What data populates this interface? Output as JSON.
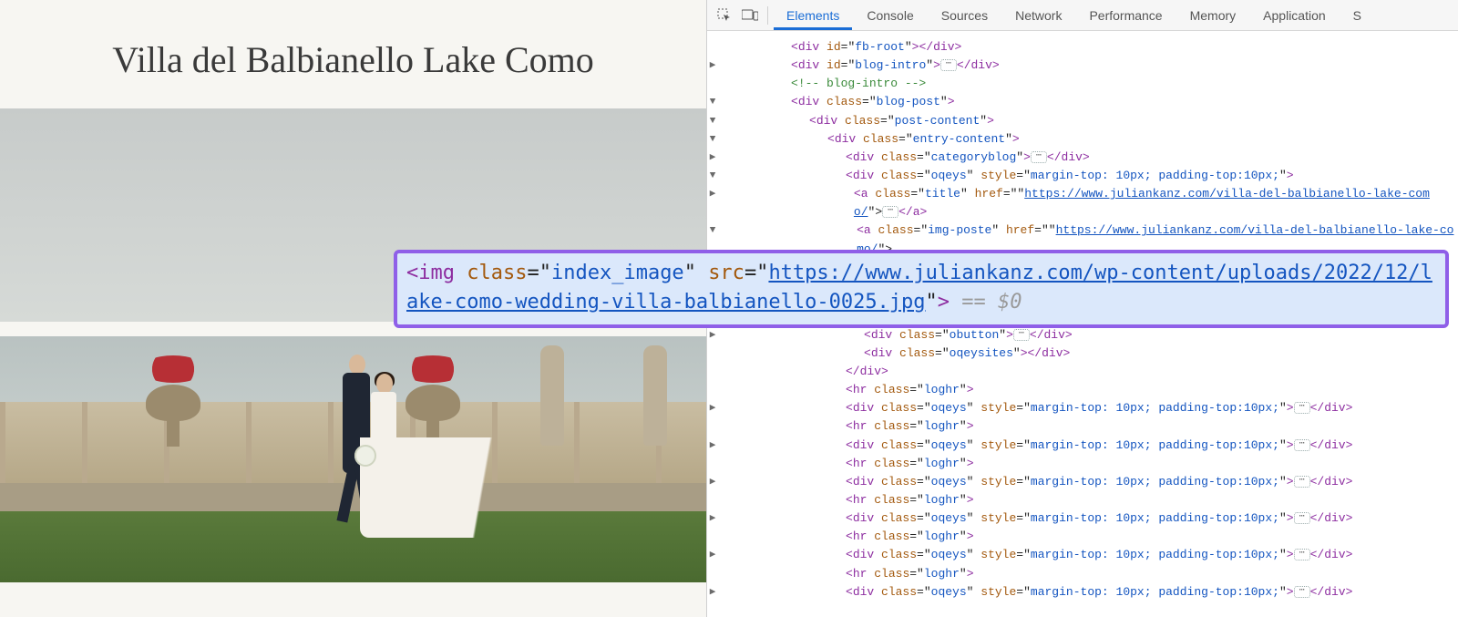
{
  "page": {
    "title": "Villa del Balbianello Lake Como"
  },
  "devtools": {
    "tabs": [
      "Elements",
      "Console",
      "Sources",
      "Network",
      "Performance",
      "Memory",
      "Application",
      "S"
    ],
    "active_tab": "Elements",
    "selected_suffix": " == $0"
  },
  "dom": {
    "l1": "<div id=\"fb-root\"></div>",
    "l2a": "<div id=\"blog-intro\">",
    "l2b": "</div>",
    "l3": "<!-- blog-intro -->",
    "l4": "<div class=\"blog-post\">",
    "l5": "<div class=\"post-content\">",
    "l6": "<div class=\"entry-content\">",
    "l7a": "<div class=\"categoryblog\">",
    "l7b": "</div>",
    "l8": "<div class=\"oqeys\" style=\"margin-top: 10px; padding-top:10px;\">",
    "l9a": "<a class=\"title\" href=\"",
    "l9url": "https://www.juliankanz.com/villa-del-balbianello-lake-como/",
    "l9b": "\">",
    "l9c": "</a>",
    "l10a": "<a class=\"img-poste\" href=\"",
    "l10url": "https://www.juliankanz.com/villa-del-balbianello-lake-como/",
    "l10b": "\">",
    "sel_a": "<img class=\"index_image\" src=\"",
    "sel_url": "https://www.juliankanz.com/wp-content/uploads/2022/12/lake-como-wedding-villa-balbianello-0025.jpg",
    "sel_b": "\">",
    "l12a": "<div class=\"obutton\">",
    "l12b": "</div>",
    "l13": "<div class=\"oqeysites\"></div>",
    "l14": "</div>",
    "l15": "<hr class=\"loghr\">",
    "rep_a": "<div class=\"oqeys\" style=\"margin-top: 10px; padding-top:10px;\">",
    "rep_b": "</div>",
    "rep_hr": "<hr class=\"loghr\">"
  }
}
